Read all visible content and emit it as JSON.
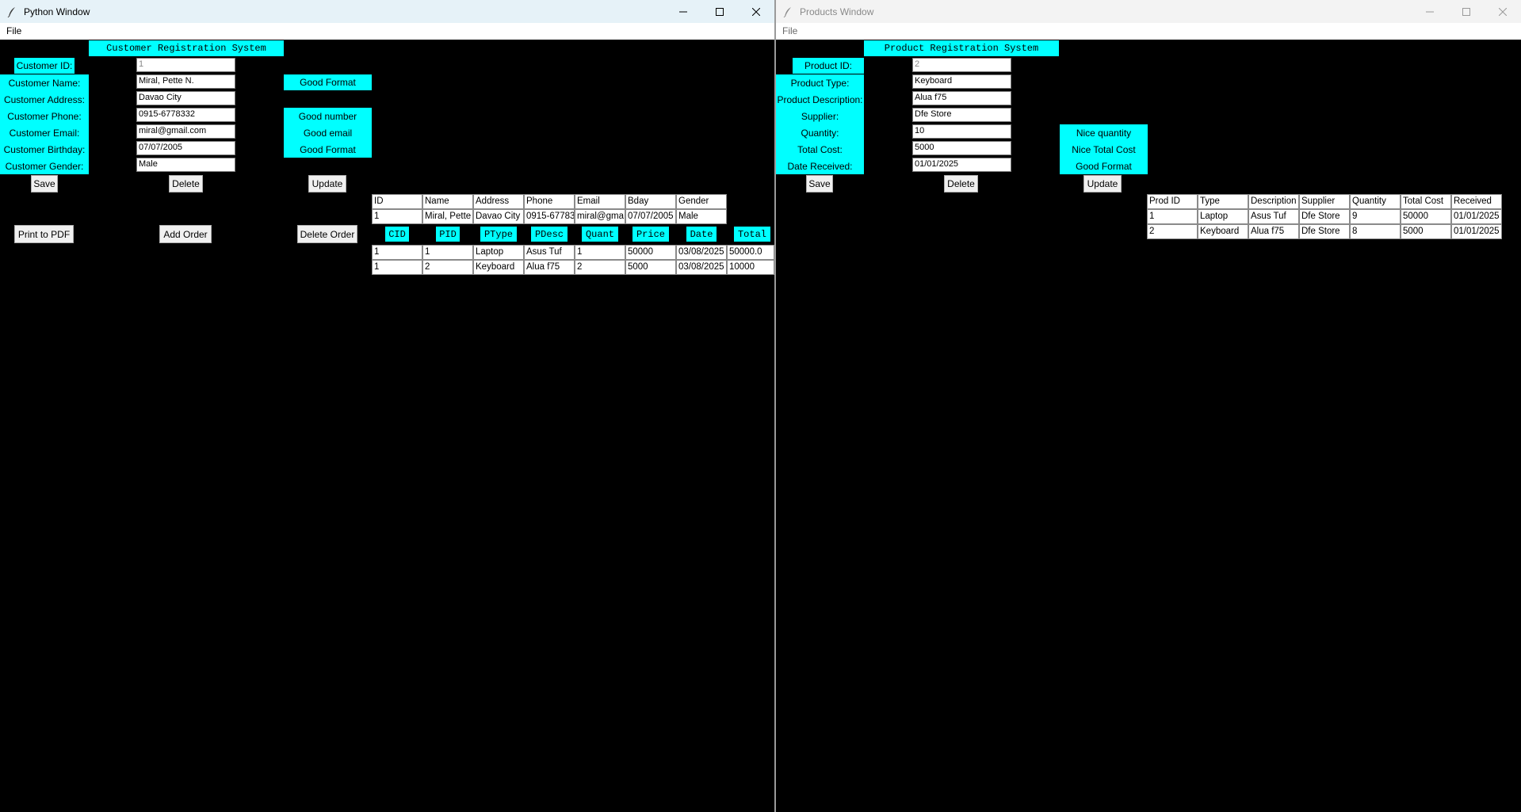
{
  "left_window": {
    "title": "Python Window",
    "menu": {
      "file": "File"
    },
    "header": "Customer Registration System",
    "fields": [
      {
        "label": "Customer ID:",
        "value": "1"
      },
      {
        "label": "Customer Name:",
        "value": "Miral, Pette N."
      },
      {
        "label": "Customer Address:",
        "value": "Davao City"
      },
      {
        "label": "Customer Phone:",
        "value": "0915-6778332"
      },
      {
        "label": "Customer Email:",
        "value": "miral@gmail.com"
      },
      {
        "label": "Customer Birthday:",
        "value": "07/07/2005"
      },
      {
        "label": "Customer Gender:",
        "value": "Male"
      }
    ],
    "validation": {
      "name": "Good Format",
      "phone": "Good number",
      "email": "Good email",
      "birthday": "Good Format"
    },
    "buttons": {
      "save": "Save",
      "delete": "Delete",
      "update": "Update",
      "print_pdf": "Print to PDF",
      "add_order": "Add Order",
      "delete_order": "Delete Order"
    },
    "customer_table": {
      "headers": [
        "ID",
        "Name",
        "Address",
        "Phone",
        "Email",
        "Bday",
        "Gender"
      ],
      "rows": [
        [
          "1",
          "Miral, Pette",
          "Davao City",
          "0915-67783",
          "miral@gma",
          "07/07/2005",
          "Male"
        ]
      ]
    },
    "order_table": {
      "headers": [
        "CID",
        "PID",
        "PType",
        "PDesc",
        "Quant",
        "Price",
        "Date",
        "Total"
      ],
      "rows": [
        [
          "1",
          "1",
          "Laptop",
          "Asus Tuf",
          "1",
          "50000",
          "03/08/2025",
          "50000.0"
        ],
        [
          "1",
          "2",
          "Keyboard",
          "Alua f75",
          "2",
          "5000",
          "03/08/2025",
          "10000"
        ]
      ]
    }
  },
  "right_window": {
    "title": "Products Window",
    "menu": {
      "file": "File"
    },
    "header": "Product Registration System",
    "fields": [
      {
        "label": "Product ID:",
        "value": "2"
      },
      {
        "label": "Product Type:",
        "value": "Keyboard"
      },
      {
        "label": "Product Description:",
        "value": "Alua f75"
      },
      {
        "label": "Supplier:",
        "value": "Dfe Store"
      },
      {
        "label": "Quantity:",
        "value": "10"
      },
      {
        "label": "Total Cost:",
        "value": "5000"
      },
      {
        "label": "Date Received:",
        "value": "01/01/2025"
      }
    ],
    "validation": {
      "quantity": "Nice quantity",
      "total_cost": "Nice Total Cost",
      "date": "Good Format"
    },
    "buttons": {
      "save": "Save",
      "delete": "Delete",
      "update": "Update"
    },
    "product_table": {
      "headers": [
        "Prod ID",
        "Type",
        "Description",
        "Supplier",
        "Quantity",
        "Total Cost",
        "Received"
      ],
      "rows": [
        [
          "1",
          "Laptop",
          "Asus Tuf",
          "Dfe Store",
          "9",
          "50000",
          "01/01/2025"
        ],
        [
          "2",
          "Keyboard",
          "Alua f75",
          "Dfe Store",
          "8",
          "5000",
          "01/01/2025"
        ]
      ]
    }
  },
  "colors": {
    "label_bg": "#00ffff",
    "window_bg": "#000000",
    "active_titlebar": "#e6f2f8",
    "inactive_titlebar": "#f3f3f3"
  }
}
